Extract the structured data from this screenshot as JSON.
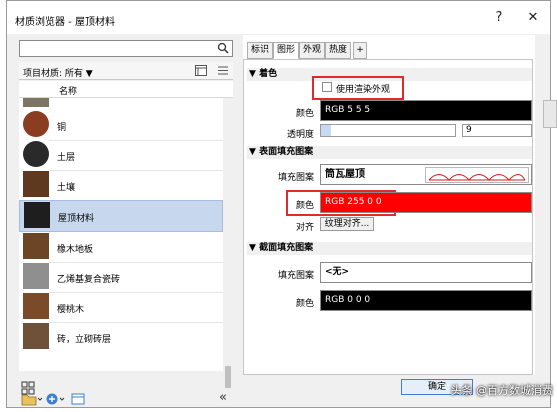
{
  "window": {
    "title": "材质浏览器 - 屋顶材料",
    "help": "?",
    "close": "✕"
  },
  "left": {
    "search_placeholder": "",
    "library_label": "项目材质: 所有",
    "column_header": "名称",
    "items": [
      {
        "label": "",
        "color": "#7c7564"
      },
      {
        "label": "铜",
        "color": "#8a3d21"
      },
      {
        "label": "土层",
        "color": "#2a2a2a"
      },
      {
        "label": "土壤",
        "color": "#5e3920"
      },
      {
        "label": "屋顶材料",
        "color": "#1e1e1e"
      },
      {
        "label": "橡木地板",
        "color": "#6b4526"
      },
      {
        "label": "乙烯基复合瓷砖",
        "color": "#8f8f8f"
      },
      {
        "label": "樱桃木",
        "color": "#7a4a2a"
      },
      {
        "label": "砖，立砌砖层",
        "color": "#6f5038"
      }
    ],
    "selected_index": 4,
    "collapse_icon": "«"
  },
  "tabs": [
    "标识",
    "图形",
    "外观",
    "热度",
    "+"
  ],
  "active_tab": 1,
  "sections": {
    "shading": {
      "title": "着色",
      "use_render_label": "使用渲染外观",
      "color_label": "颜色",
      "color_value": "RGB 5 5 5",
      "transparency_label": "透明度",
      "transparency_value": "9"
    },
    "surface": {
      "title": "表面填充图案",
      "pattern_label": "填充图案",
      "pattern_value": "筒瓦屋顶",
      "color_label": "颜色",
      "color_value": "RGB 255 0 0",
      "align_label": "对齐",
      "align_value": "纹理对齐..."
    },
    "cut": {
      "title": "截面填充图案",
      "pattern_label": "填充图案",
      "pattern_value": "<无>",
      "color_label": "颜色",
      "color_value": "RGB 0 0 0"
    }
  },
  "footer": {
    "ok": "确定"
  },
  "watermark": "头条 @百方数城消费",
  "colors": {
    "accent": "#e32a2a",
    "selection": "#c7d8ee"
  }
}
